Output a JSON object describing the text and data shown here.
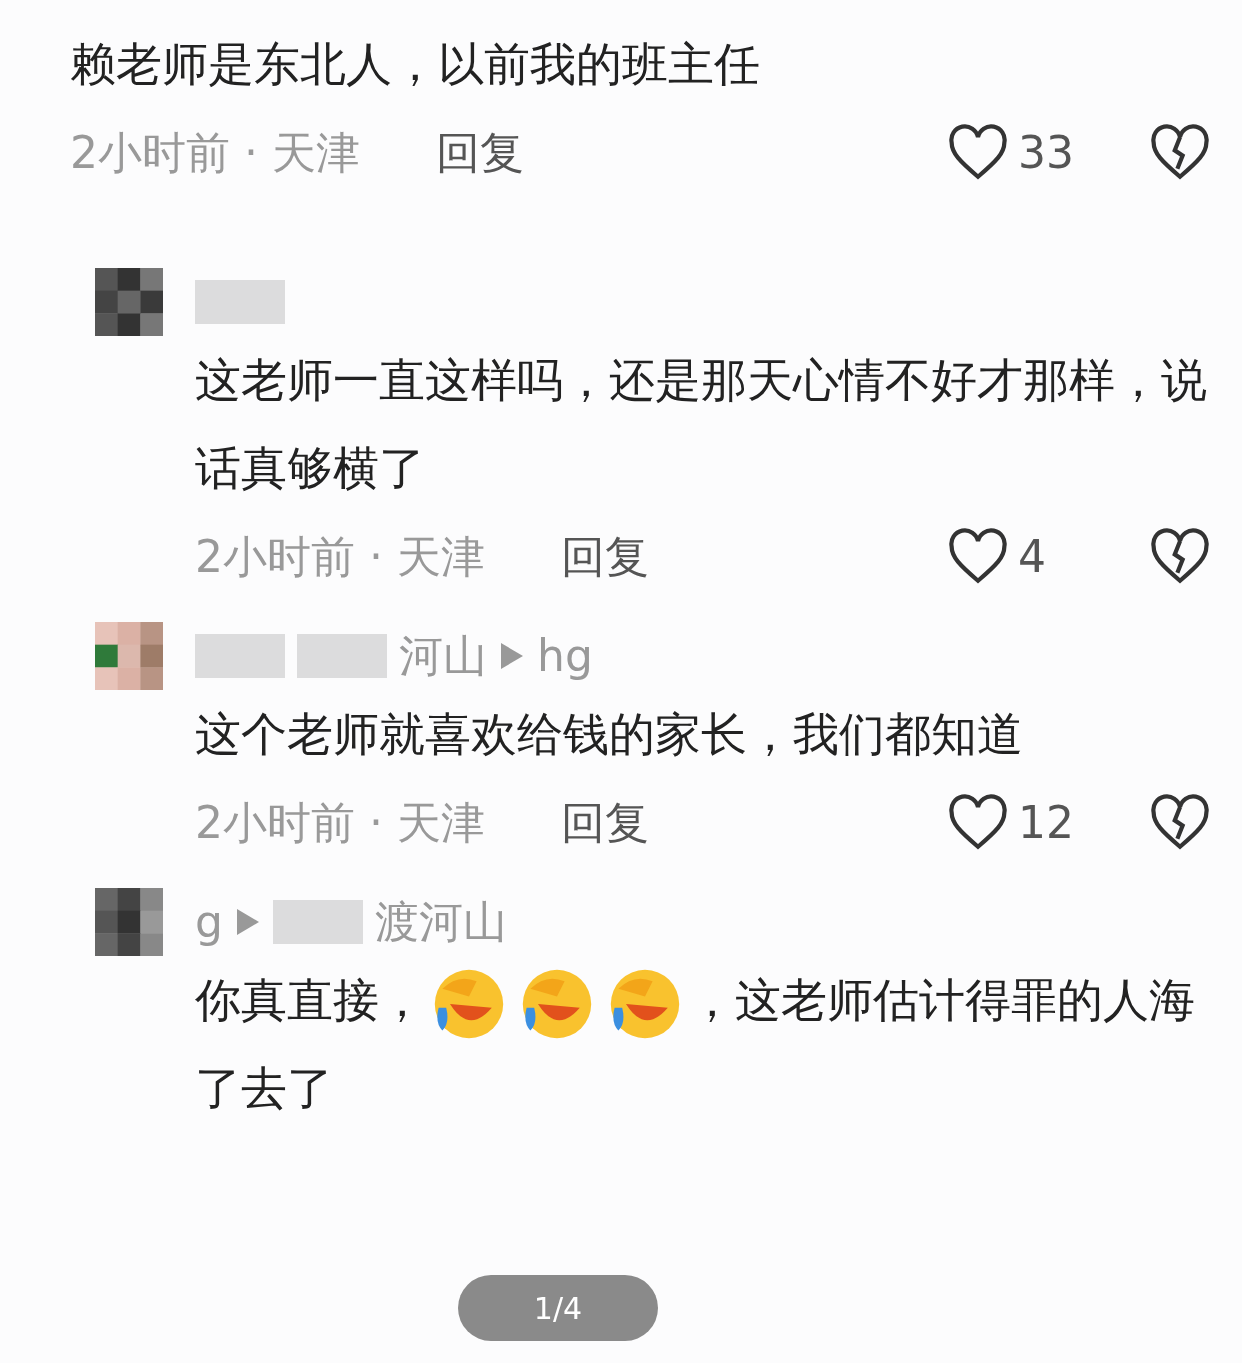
{
  "comment": {
    "text": [
      {
        "kind": "text",
        "text": "赖老师是东北人，以前我的班主任"
      }
    ],
    "time": "2小时前",
    "separator": "·",
    "location": "天津",
    "reply": "回复",
    "likes": "33",
    "children": [
      {
        "header": [
          {
            "kind": "blurred"
          }
        ],
        "text": [
          {
            "kind": "text",
            "text": "这老师一直这样吗，还是那天心情不好才那样，说话真够横了"
          }
        ],
        "time": "2小时前",
        "separator": "·",
        "location": "天津",
        "reply": "回复",
        "likes": "4"
      },
      {
        "header": [
          {
            "kind": "blurred"
          },
          {
            "kind": "blurred"
          },
          {
            "kind": "name",
            "text": "河山"
          },
          {
            "kind": "arrow"
          },
          {
            "kind": "name",
            "text": "hg"
          }
        ],
        "text": [
          {
            "kind": "text",
            "text": "这个老师就喜欢给钱的家长，我们都知道"
          }
        ],
        "time": "2小时前",
        "separator": "·",
        "location": "天津",
        "reply": "回复",
        "likes": "12"
      },
      {
        "header": [
          {
            "kind": "name",
            "text": "g"
          },
          {
            "kind": "arrow"
          },
          {
            "kind": "blurred"
          },
          {
            "kind": "name",
            "text": "渡河山"
          }
        ],
        "text": [
          {
            "kind": "text",
            "text": "你真直接，"
          },
          {
            "kind": "emoji"
          },
          {
            "kind": "emoji"
          },
          {
            "kind": "emoji"
          },
          {
            "kind": "text",
            "text": "，这老师估计得罪的人海了去了"
          }
        ]
      }
    ]
  },
  "pager": "1/4"
}
